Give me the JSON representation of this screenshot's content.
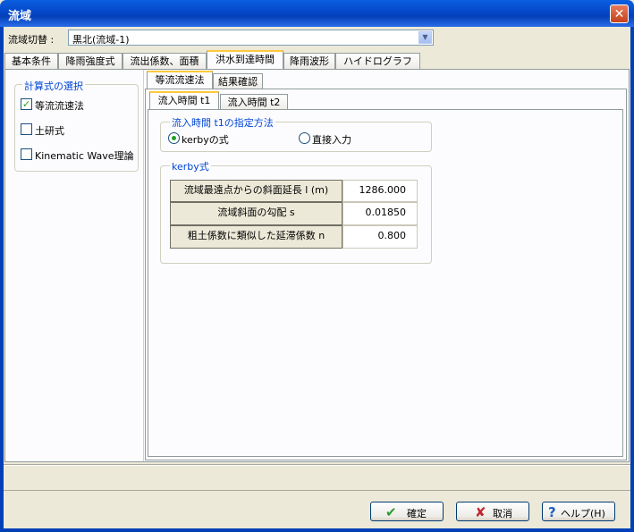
{
  "window": {
    "title": "流域",
    "close_symbol": "✕"
  },
  "header": {
    "switch_label": "流域切替 :",
    "switch_value": "黒北(流域-1)",
    "dropdown_symbol": "▼"
  },
  "main_tabs": [
    "基本条件",
    "降雨強度式",
    "流出係数、面積",
    "洪水到達時間",
    "降雨波形",
    "ハイドログラフ"
  ],
  "calc_group": {
    "title": "計算式の選択",
    "options": [
      {
        "label": "等流流速法",
        "checked": true
      },
      {
        "label": "土研式",
        "checked": false
      },
      {
        "label": "Kinematic Wave理論",
        "checked": false
      }
    ]
  },
  "sub_tabs": [
    "等流流速法",
    "結果確認"
  ],
  "inner_tabs": [
    "流入時間 t1",
    "流入時間 t2"
  ],
  "method_group": {
    "title": "流入時間 t1の指定方法",
    "options": [
      {
        "label": "kerbyの式",
        "selected": true
      },
      {
        "label": "直接入力",
        "selected": false
      }
    ]
  },
  "kerby_group": {
    "title": "kerby式",
    "rows": [
      {
        "label": "流域最遠点からの斜面延長 l (m)",
        "value": "1286.000"
      },
      {
        "label": "流域斜面の勾配 s",
        "value": "0.01850"
      },
      {
        "label": "粗土係数に類似した延滞係数 n",
        "value": "0.800"
      }
    ]
  },
  "buttons": {
    "ok": {
      "label": "確定",
      "icon": "✔"
    },
    "cancel": {
      "label": "取消",
      "icon": "✘"
    },
    "help": {
      "label": "ヘルプ(H)",
      "icon": "?"
    }
  },
  "colors": {
    "title_bar": "#0547c9",
    "group_title": "#0046d5",
    "check_mark": "#21a121",
    "tab_highlight": "#ffc83c"
  }
}
